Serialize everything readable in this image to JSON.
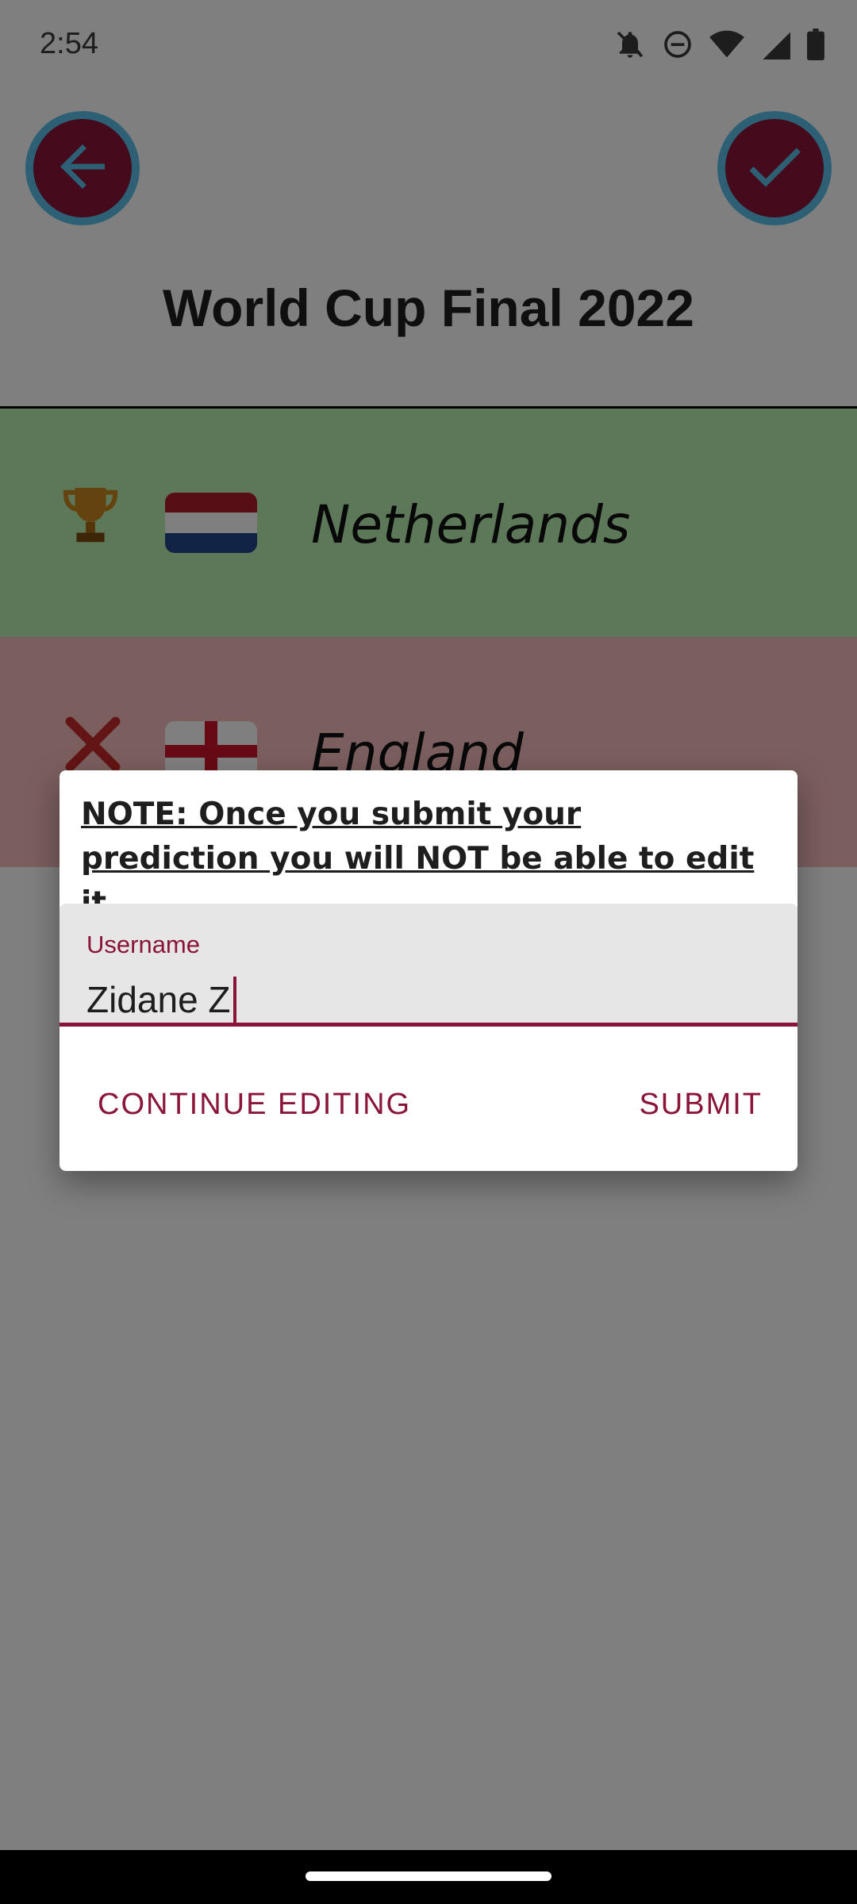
{
  "status_bar": {
    "time": "2:54",
    "icons": [
      "notifications-off-icon",
      "do-not-disturb-icon",
      "wifi-icon",
      "cell-signal-icon",
      "battery-icon"
    ]
  },
  "header": {
    "title": "World Cup Final 2022",
    "back_icon": "arrow-left-icon",
    "confirm_icon": "checkmark-icon"
  },
  "teams": [
    {
      "name": "Netherlands",
      "result_icon": "trophy-icon",
      "flag": "netherlands-flag",
      "status": "winner"
    },
    {
      "name": "England",
      "result_icon": "cross-icon",
      "flag": "england-flag",
      "status": "loser"
    }
  ],
  "dialog": {
    "note": "NOTE: Once you submit your prediction you will NOT be able to edit it.",
    "username_label": "Username",
    "username_value": "Zidane Z",
    "continue_label": "CONTINUE EDITING",
    "submit_label": "SUBMIT"
  },
  "colors": {
    "accent": "#8a1538",
    "ring": "#5bc0eb",
    "winner_bg": "#b8f0b0",
    "loser_bg": "#f7bcbc"
  }
}
